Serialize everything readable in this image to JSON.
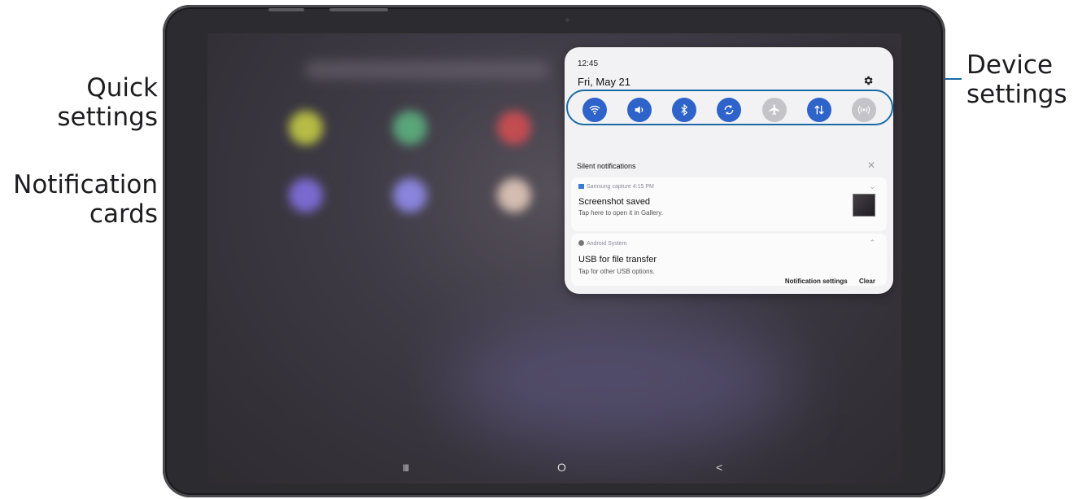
{
  "callouts": {
    "quick_settings": [
      "Quick",
      "settings"
    ],
    "notification_cards": [
      "Notification",
      "cards"
    ],
    "device_settings": [
      "Device",
      "settings"
    ]
  },
  "status": {
    "time": "12:45",
    "date": "Fri, May 21"
  },
  "quick_settings": [
    {
      "icon": "wifi-icon",
      "state": "on"
    },
    {
      "icon": "sound-icon",
      "state": "on"
    },
    {
      "icon": "bluetooth-icon",
      "state": "on"
    },
    {
      "icon": "auto-rotate-icon",
      "state": "on"
    },
    {
      "icon": "airplane-mode-icon",
      "state": "off"
    },
    {
      "icon": "mobile-data-icon",
      "state": "on"
    },
    {
      "icon": "hotspot-icon",
      "state": "off"
    }
  ],
  "notifications": {
    "section_title": "Silent notifications",
    "cards": [
      {
        "source": "Samsung capture  4:15 PM",
        "title": "Screenshot saved",
        "subtitle": "Tap here to open it in Gallery."
      },
      {
        "source": "Android System",
        "title": "USB for file transfer",
        "subtitle": "Tap for other USB options."
      }
    ],
    "settings_label": "Notification settings",
    "clear_label": "Clear"
  },
  "nav": {
    "recents": "III",
    "home": "O",
    "back": "<"
  },
  "colors": {
    "accent": "#2e63c9",
    "leader": "#1b6aa5"
  }
}
